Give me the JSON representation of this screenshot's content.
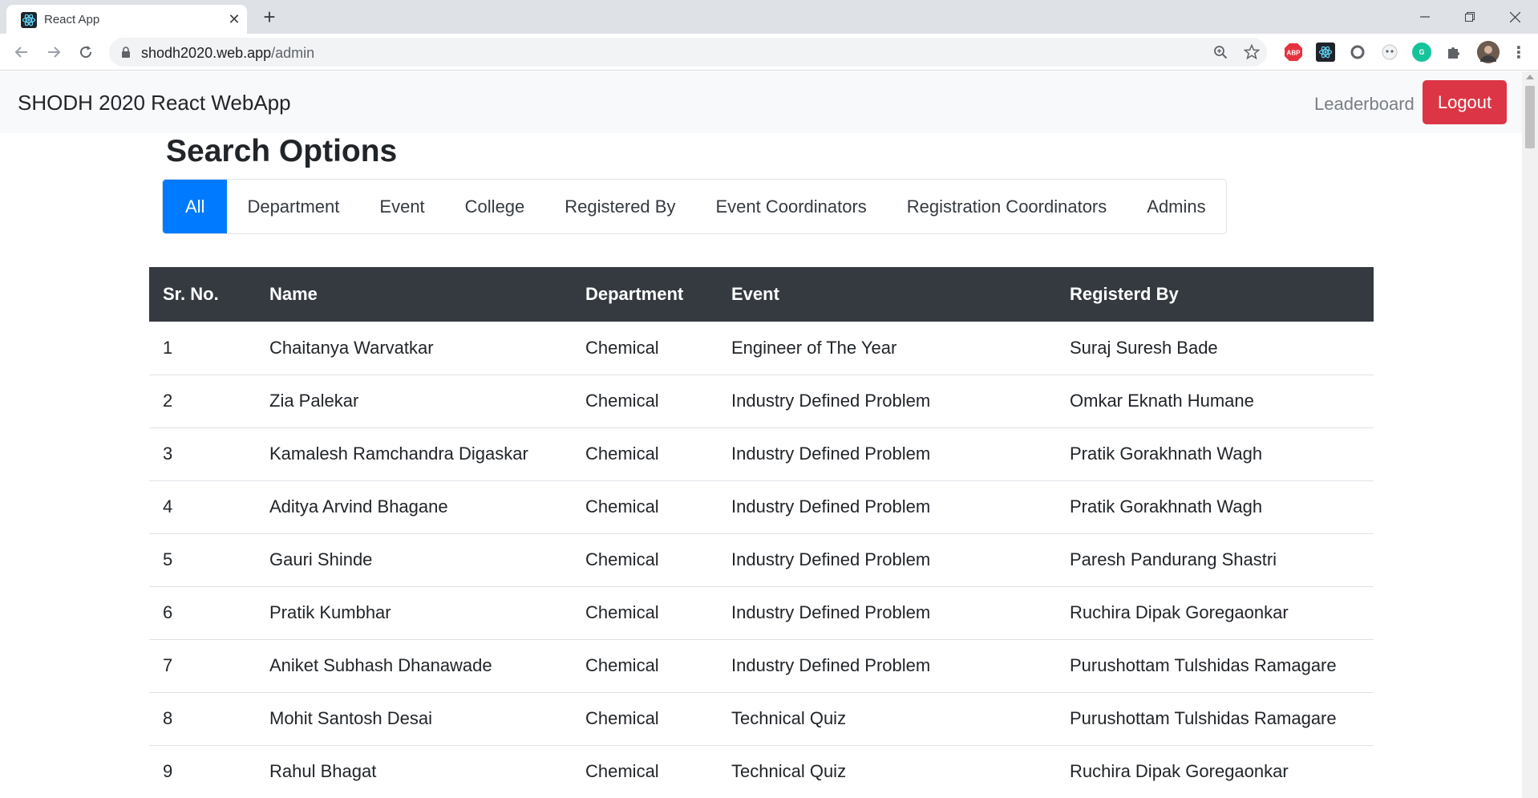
{
  "browser": {
    "tab_title": "React App",
    "url_host": "shodh2020.web.app",
    "url_path": "/admin",
    "extensions": [
      {
        "name": "adblock-plus-icon",
        "label": "ABP",
        "color": "#e6323e"
      },
      {
        "name": "react-devtools-icon",
        "label": "",
        "color": "#20232a"
      },
      {
        "name": "circle-extension-icon",
        "label": "",
        "color": "#5f6368"
      },
      {
        "name": "panda-extension-icon",
        "label": "",
        "color": "#e8eaed"
      },
      {
        "name": "grammarly-icon",
        "label": "G",
        "color": "#15c39a"
      }
    ]
  },
  "navbar": {
    "brand": "SHODH 2020 React WebApp",
    "leaderboard_label": "Leaderboard",
    "logout_label": "Logout"
  },
  "search": {
    "title": "Search Options",
    "filters": [
      "All",
      "Department",
      "Event",
      "College",
      "Registered By",
      "Event Coordinators",
      "Registration Coordinators",
      "Admins"
    ],
    "active_filter": "All"
  },
  "table": {
    "headers": [
      "Sr. No.",
      "Name",
      "Department",
      "Event",
      "Registerd By"
    ],
    "rows": [
      [
        "1",
        "Chaitanya Warvatkar",
        "Chemical",
        "Engineer of The Year",
        "Suraj Suresh Bade"
      ],
      [
        "2",
        "Zia Palekar",
        "Chemical",
        "Industry Defined Problem",
        "Omkar Eknath Humane"
      ],
      [
        "3",
        "Kamalesh Ramchandra Digaskar",
        "Chemical",
        "Industry Defined Problem",
        "Pratik Gorakhnath Wagh"
      ],
      [
        "4",
        "Aditya Arvind Bhagane",
        "Chemical",
        "Industry Defined Problem",
        "Pratik Gorakhnath Wagh"
      ],
      [
        "5",
        "Gauri Shinde",
        "Chemical",
        "Industry Defined Problem",
        "Paresh Pandurang Shastri"
      ],
      [
        "6",
        "Pratik Kumbhar",
        "Chemical",
        "Industry Defined Problem",
        "Ruchira Dipak Goregaonkar"
      ],
      [
        "7",
        "Aniket Subhash Dhanawade",
        "Chemical",
        "Industry Defined Problem",
        "Purushottam Tulshidas Ramagare"
      ],
      [
        "8",
        "Mohit Santosh Desai",
        "Chemical",
        "Technical Quiz",
        "Purushottam Tulshidas Ramagare"
      ],
      [
        "9",
        "Rahul Bhagat",
        "Chemical",
        "Technical Quiz",
        "Ruchira Dipak Goregaonkar"
      ]
    ]
  },
  "colors": {
    "primary": "#007bff",
    "danger": "#dc3545",
    "table_header": "#343a40"
  }
}
